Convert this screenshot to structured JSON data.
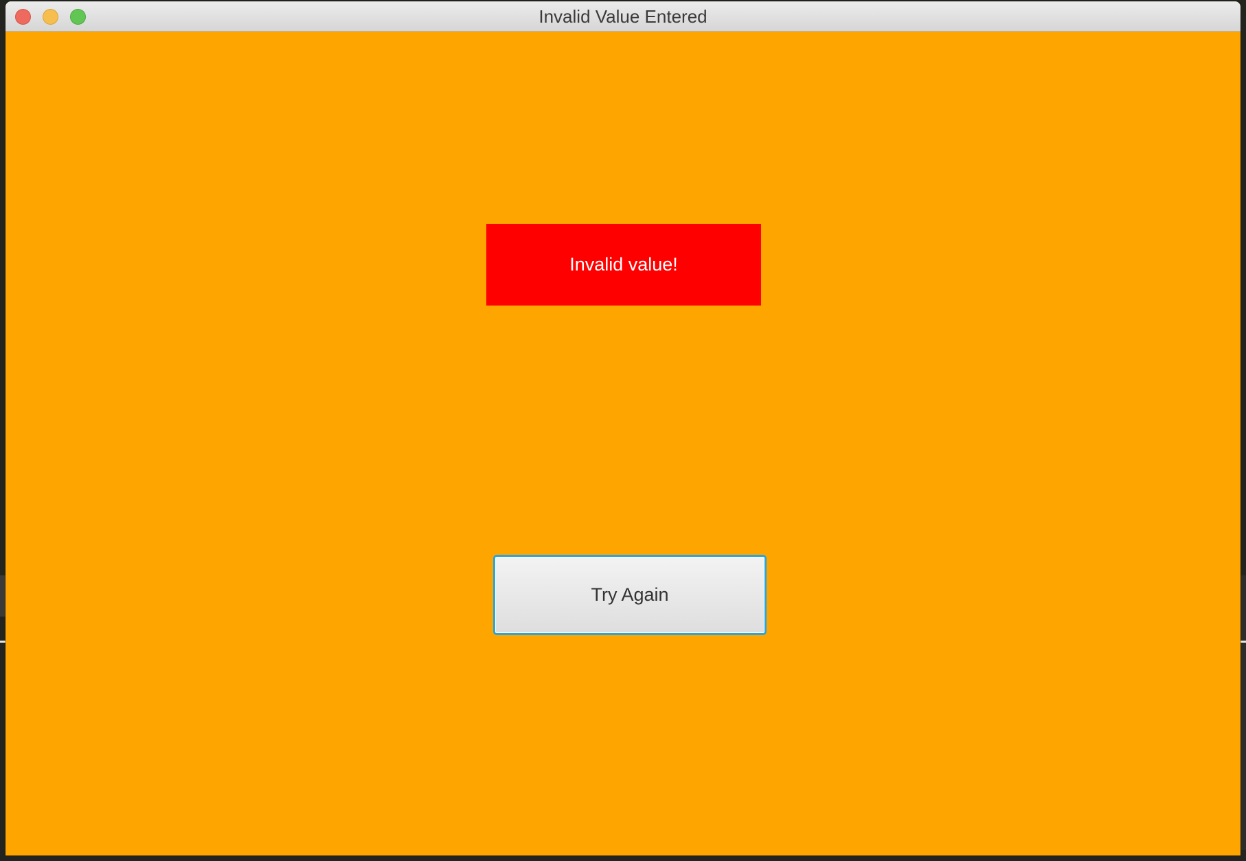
{
  "window": {
    "title": "Invalid Value Entered"
  },
  "content": {
    "error_message": "Invalid value!",
    "try_again_label": "Try Again"
  },
  "colors": {
    "background": "#ffa500",
    "error_box": "#ff0000",
    "focus_ring": "#2aa6dc"
  }
}
